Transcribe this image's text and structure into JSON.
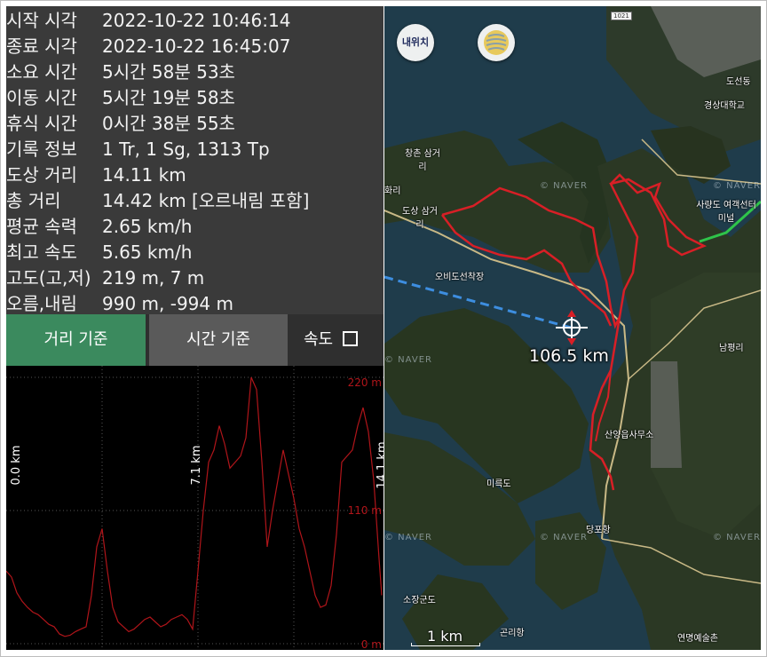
{
  "stats": [
    {
      "label": "시작 시각",
      "value": "2022-10-22 10:46:14"
    },
    {
      "label": "종료 시각",
      "value": "2022-10-22 16:45:07"
    },
    {
      "label": "소요 시간",
      "value": "5시간 58분 53초"
    },
    {
      "label": "이동 시간",
      "value": "5시간 19분 58초"
    },
    {
      "label": "휴식 시간",
      "value": "0시간 38분 55초"
    },
    {
      "label": "기록 정보",
      "value": "1 Tr, 1 Sg, 1313 Tp"
    },
    {
      "label": "도상 거리",
      "value": "14.11 km"
    },
    {
      "label": "총 거리",
      "value": "14.42 km [오르내림 포함]"
    },
    {
      "label": "평균 속력",
      "value": "2.65 km/h"
    },
    {
      "label": "최고 속도",
      "value": "5.65 km/h"
    },
    {
      "label": "고도(고,저)",
      "value": "219 m, 7 m"
    },
    {
      "label": "오름,내림",
      "value": "990 m, -994 m"
    }
  ],
  "buttons": {
    "distance_basis": "거리 기준",
    "time_basis": "시간 기준",
    "speed_label": "속도",
    "speed_checked": false
  },
  "chart_data": {
    "type": "line",
    "x_marker_labels": [
      "0.0 km",
      "7.1 km",
      "14.1 km"
    ],
    "x_markers": [
      0.0,
      7.1,
      14.1
    ],
    "y_tick_labels": [
      "220 m",
      "110 m",
      "0 m"
    ],
    "y_ticks": [
      220,
      110,
      0
    ],
    "ylim": [
      0,
      220
    ],
    "xlim": [
      0,
      14.1
    ],
    "line_color": "#b0151a",
    "grid": true,
    "x": [
      0.0,
      0.2,
      0.4,
      0.6,
      0.8,
      1.0,
      1.2,
      1.4,
      1.6,
      1.8,
      2.0,
      2.2,
      2.4,
      2.6,
      2.8,
      3.0,
      3.2,
      3.4,
      3.6,
      3.8,
      4.0,
      4.2,
      4.4,
      4.6,
      4.8,
      5.0,
      5.2,
      5.4,
      5.6,
      5.8,
      6.0,
      6.2,
      6.4,
      6.6,
      6.8,
      7.0,
      7.2,
      7.4,
      7.6,
      7.8,
      8.0,
      8.2,
      8.4,
      8.6,
      8.8,
      9.0,
      9.2,
      9.4,
      9.6,
      9.8,
      10.0,
      10.2,
      10.4,
      10.6,
      10.8,
      11.0,
      11.2,
      11.4,
      11.6,
      11.8,
      12.0,
      12.2,
      12.4,
      12.6,
      12.8,
      13.0,
      13.2,
      13.4,
      13.6,
      13.8,
      14.0,
      14.1
    ],
    "y": [
      60,
      55,
      42,
      35,
      30,
      26,
      24,
      20,
      16,
      14,
      8,
      6,
      7,
      10,
      12,
      14,
      40,
      80,
      95,
      60,
      30,
      18,
      14,
      10,
      12,
      16,
      20,
      22,
      18,
      14,
      16,
      20,
      22,
      24,
      20,
      12,
      60,
      110,
      150,
      160,
      180,
      165,
      145,
      150,
      155,
      170,
      220,
      210,
      150,
      80,
      110,
      135,
      160,
      140,
      120,
      95,
      80,
      60,
      40,
      30,
      32,
      48,
      90,
      150,
      155,
      160,
      180,
      195,
      175,
      135,
      70,
      40
    ]
  },
  "map": {
    "my_location_label": "내위치",
    "distance_readout": "106.5 km",
    "scale_label": "1 km",
    "watermark": "© NAVER",
    "labels": [
      {
        "text": "도선동"
      },
      {
        "text": "경상대학교"
      },
      {
        "text": "창촌 삼거리"
      },
      {
        "text": "화리"
      },
      {
        "text": "도상 삼거리"
      },
      {
        "text": "사량도 여객선터미널"
      },
      {
        "text": "오비도선착장"
      },
      {
        "text": "남평리"
      },
      {
        "text": "산양읍사무소"
      },
      {
        "text": "미륵도"
      },
      {
        "text": "당포항"
      },
      {
        "text": "소장군도"
      },
      {
        "text": "곤리항"
      },
      {
        "text": "연명예술촌"
      }
    ],
    "road_sign": "1021"
  }
}
